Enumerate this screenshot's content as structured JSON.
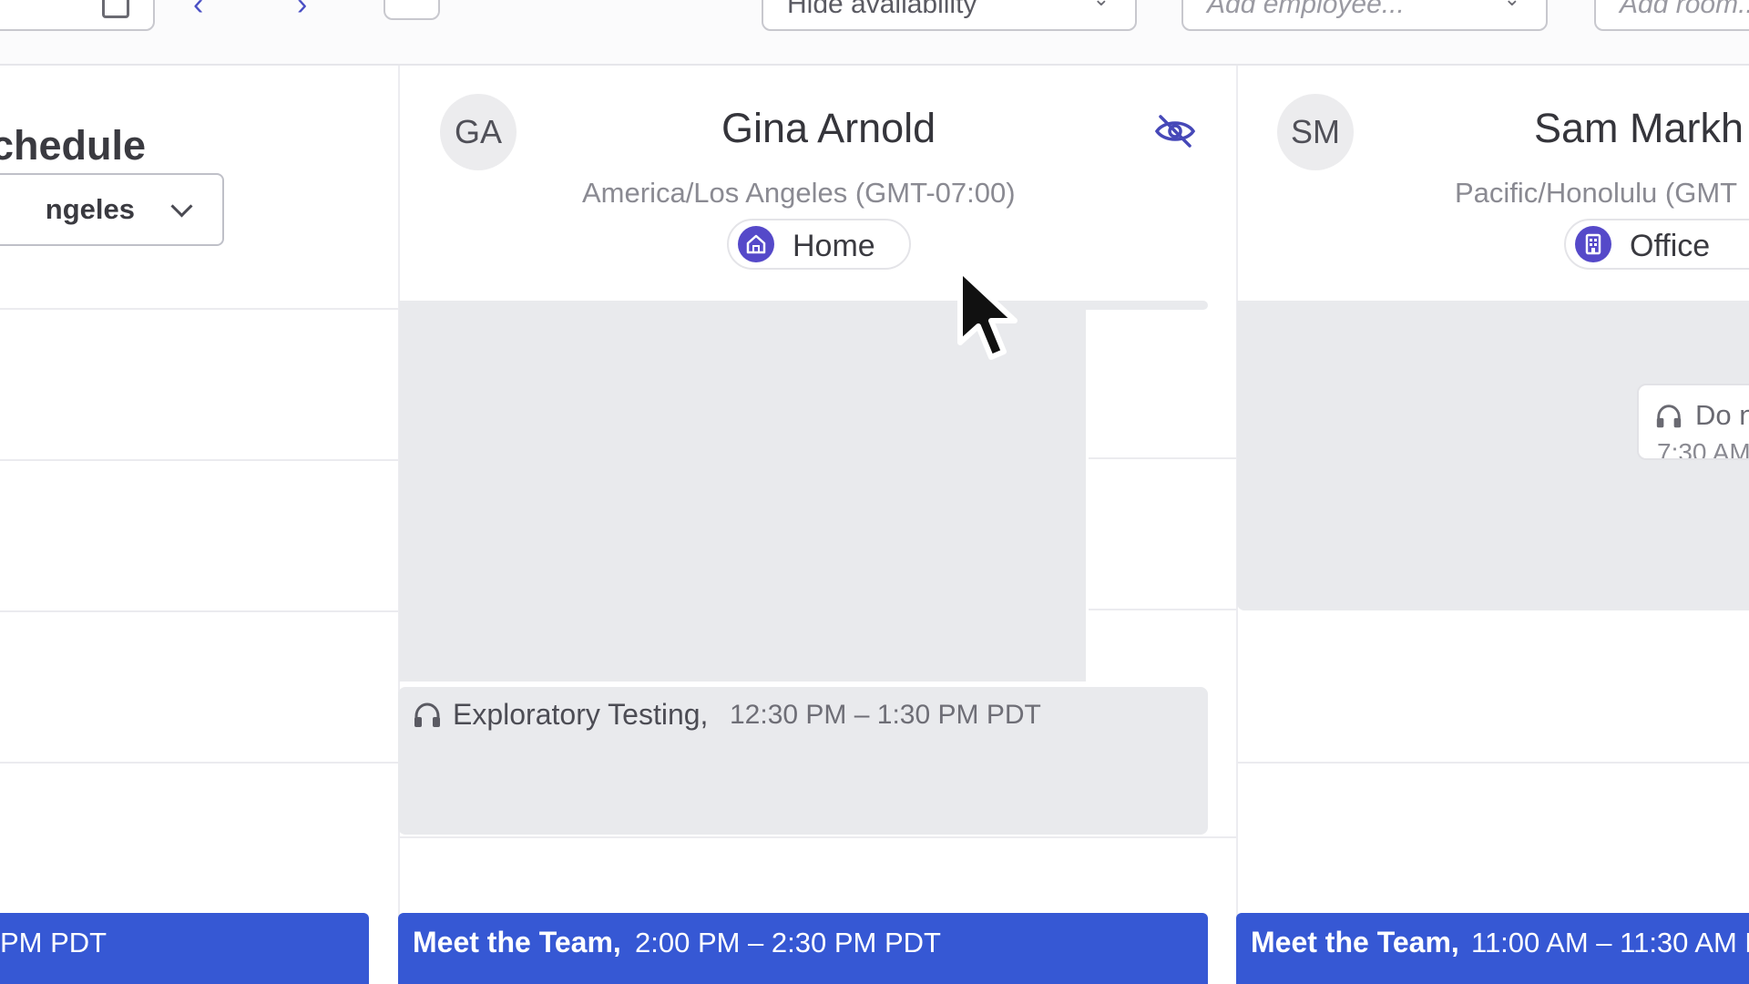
{
  "toolbar": {
    "availability_filter": "Hide availability",
    "employee_placeholder": "Add employee...",
    "room_placeholder": "Add room..."
  },
  "left_column": {
    "title": "chedule",
    "timezone_value": "ngeles",
    "meeting_time_fragment": "PM PDT"
  },
  "employees": [
    {
      "initials": "GA",
      "name": "Gina Arnold",
      "timezone": "America/Los Angeles (GMT-07:00)",
      "location": "Home",
      "location_icon": "home-icon",
      "visibility_icon": "eye-off-icon",
      "events": [
        {
          "title": "Exploratory Testing,",
          "time": "12:30 PM – 1:30 PM PDT",
          "icon": "headphones-icon"
        }
      ],
      "meeting": {
        "title": "Meet the Team,",
        "time": "2:00 PM – 2:30 PM PDT"
      }
    },
    {
      "initials": "SM",
      "name": "Sam Markh",
      "timezone": "Pacific/Honolulu (GMT",
      "location": "Office",
      "location_icon": "building-icon",
      "events": [
        {
          "title": "Do n",
          "time": "7:30 AM",
          "icon": "headphones-icon"
        }
      ],
      "meeting": {
        "title": "Meet the Team,",
        "time": "11:00 AM – 11:30 AM P"
      }
    }
  ],
  "colors": {
    "accent": "#3658d4",
    "location_icon_bg": "#5549c9",
    "availability_block": "#e9eaed"
  }
}
